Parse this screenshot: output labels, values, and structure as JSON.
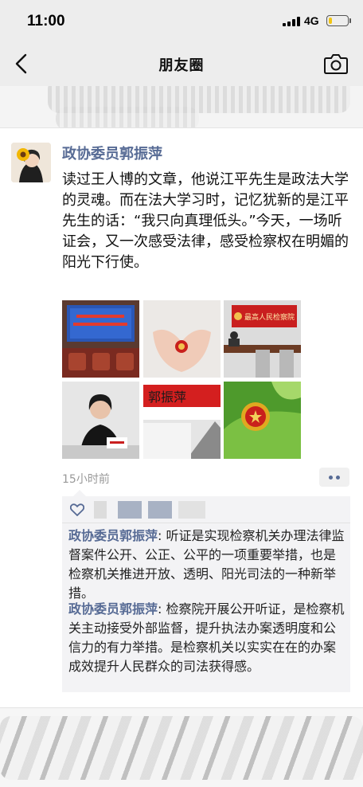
{
  "status_bar": {
    "time": "11:00",
    "network": "4G",
    "battery_level": 0.2,
    "battery_color": "#f2c511"
  },
  "nav": {
    "title": "朋友圈",
    "back_icon": "chevron-left-icon",
    "camera_icon": "camera-icon"
  },
  "post": {
    "author": "政协委员郭振萍",
    "text": "读过王人博的文章，他说江平先生是政法大学的灵魂。而在法大学习时，记忆犹新的是江平先生的话：“我只向真理低头。”今天，一场听证会，又一次感受法律，感受检察权在明媚的阳光下行使。",
    "photo_texts": {
      "board_sign": "最高人民检察院",
      "name_plate": "郭振萍"
    },
    "timestamp": "15小时前",
    "more_icon": "more-dots-icon",
    "like_icon": "heart-icon",
    "comments": [
      {
        "author": "政协委员郭振萍",
        "separator": ": ",
        "text": "听证是实现检察机关办理法律监督案件公开、公正、公平的一项重要举措，也是检察机关推进开放、透明、阳光司法的一种新举措。"
      },
      {
        "author": "政协委员郭振萍",
        "separator": ": ",
        "text": "检察院开展公开听证，是检察机关主动接受外部监督，提升执法办案透明度和公信力的有力举措。是检察机关以实实在在的办案成效提升人民群众的司法获得感。"
      }
    ]
  },
  "colors": {
    "name_link": "#576b95",
    "header_bg": "#ededed",
    "comment_bg": "#f3f3f5",
    "time_gray": "#999999"
  }
}
